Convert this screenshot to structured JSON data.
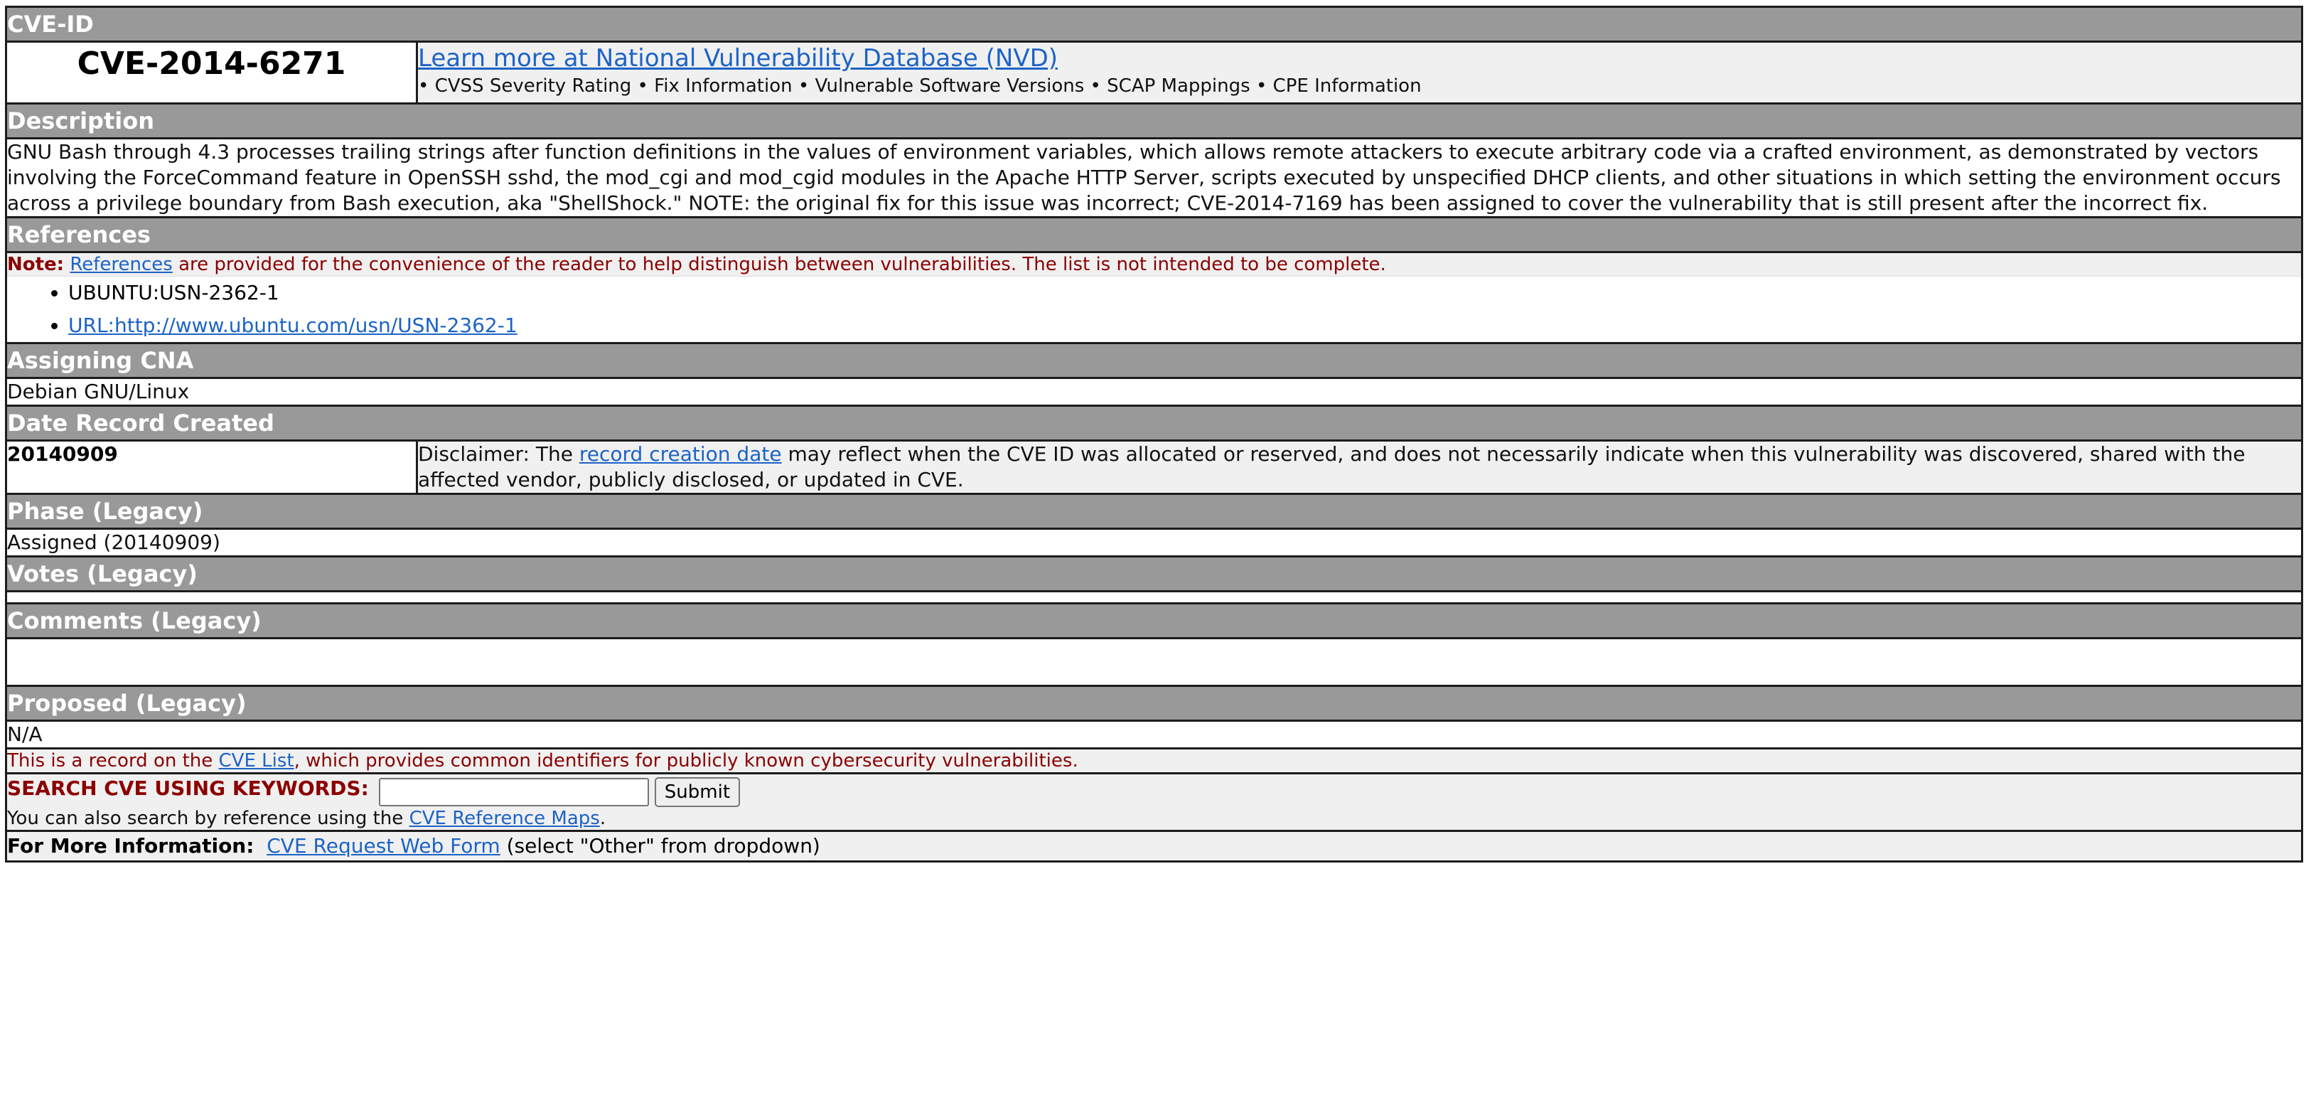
{
  "cve_id": {
    "header": "CVE-ID",
    "value": "CVE-2014-6271",
    "nvd_link": "Learn more at National Vulnerability Database (NVD)",
    "nvd_sub": "• CVSS Severity Rating • Fix Information • Vulnerable Software Versions • SCAP Mappings • CPE Information"
  },
  "description": {
    "header": "Description",
    "text": "GNU Bash through 4.3 processes trailing strings after function definitions in the values of environment variables, which allows remote attackers to execute arbitrary code via a crafted environment, as demonstrated by vectors involving the ForceCommand feature in OpenSSH sshd, the mod_cgi and mod_cgid modules in the Apache HTTP Server, scripts executed by unspecified DHCP clients, and other situations in which setting the environment occurs across a privilege boundary from Bash execution, aka \"ShellShock.\" NOTE: the original fix for this issue was incorrect; CVE-2014-7169 has been assigned to cover the vulnerability that is still present after the incorrect fix."
  },
  "references": {
    "header": "References",
    "note_label": "Note:",
    "note_link": "References",
    "note_text": " are provided for the convenience of the reader to help distinguish between vulnerabilities. The list is not intended to be complete.",
    "items": [
      {
        "text": "UBUNTU:USN-2362-1"
      },
      {
        "text": "URL:http://www.ubuntu.com/usn/USN-2362-1"
      }
    ]
  },
  "assigning_cna": {
    "header": "Assigning CNA",
    "value": "Debian GNU/Linux"
  },
  "date_created": {
    "header": "Date Record Created",
    "value": "20140909",
    "disclaimer_prefix": "Disclaimer: The ",
    "disclaimer_link": "record creation date",
    "disclaimer_suffix": " may reflect when the CVE ID was allocated or reserved, and does not necessarily indicate when this vulnerability was discovered, shared with the affected vendor, publicly disclosed, or updated in CVE."
  },
  "phase": {
    "header": "Phase (Legacy)",
    "value": "Assigned (20140909)"
  },
  "votes": {
    "header": "Votes (Legacy)"
  },
  "comments": {
    "header": "Comments (Legacy)"
  },
  "proposed": {
    "header": "Proposed (Legacy)",
    "value": "N/A"
  },
  "footer": {
    "record_prefix": "This is a record on the ",
    "record_link": "CVE List",
    "record_suffix": ", which provides common identifiers for publicly known cybersecurity vulnerabilities.",
    "search_label": "SEARCH CVE USING KEYWORDS:",
    "search_value": "",
    "submit_label": "Submit",
    "search_sub_prefix": "You can also search by reference using the ",
    "search_sub_link": "CVE Reference Maps",
    "search_sub_suffix": ".",
    "more_label": "For More Information:",
    "more_link": "CVE Request Web Form",
    "more_suffix": " (select \"Other\" from dropdown)"
  },
  "colors": {
    "header_bg": "#999999",
    "link": "#1c63c6",
    "note_red": "#8b0000",
    "grey_row": "#f0f0f0"
  }
}
